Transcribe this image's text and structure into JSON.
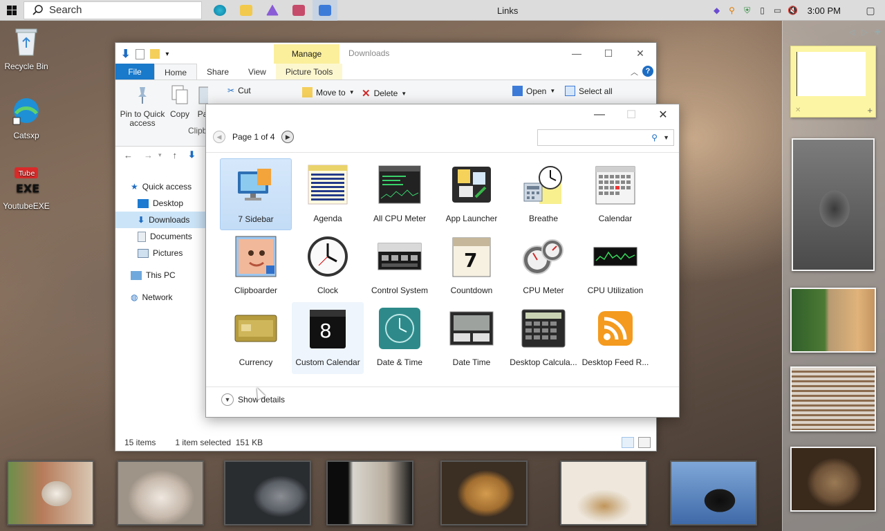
{
  "taskbar": {
    "search_placeholder": "Search",
    "window_title": "Links",
    "clock": "3:00 PM"
  },
  "desktop_icons": [
    {
      "label": "Recycle Bin"
    },
    {
      "label": "Catsxp"
    },
    {
      "label": "YoutubeEXE"
    }
  ],
  "explorer": {
    "manage_tab": "Manage",
    "title": "Downloads",
    "tabs": {
      "file": "File",
      "home": "Home",
      "share": "Share",
      "view": "View",
      "picture_tools": "Picture Tools"
    },
    "ribbon": {
      "pin": "Pin to Quick access",
      "copy": "Copy",
      "paste": "Pa",
      "cut": "Cut",
      "move_to": "Move to",
      "delete": "Delete",
      "open": "Open",
      "select_all": "Select all",
      "clipboard_group": "Clipb"
    },
    "nav": [
      {
        "label": "Quick access"
      },
      {
        "label": "Desktop"
      },
      {
        "label": "Downloads"
      },
      {
        "label": "Documents"
      },
      {
        "label": "Pictures"
      },
      {
        "label": "This PC"
      },
      {
        "label": "Network"
      }
    ],
    "status": {
      "items": "15 items",
      "selected": "1 item selected  151 KB"
    }
  },
  "gadgets": {
    "page": "Page 1 of 4",
    "search_placeholder": "",
    "items": [
      {
        "label": "7 Sidebar",
        "icon": "monitor-icon"
      },
      {
        "label": "Agenda",
        "icon": "agenda-icon"
      },
      {
        "label": "All CPU Meter",
        "icon": "cpu-meter-icon"
      },
      {
        "label": "App Launcher",
        "icon": "app-launcher-icon"
      },
      {
        "label": "Breathe",
        "icon": "breathe-icon"
      },
      {
        "label": "Calendar",
        "icon": "calendar-icon"
      },
      {
        "label": "Clipboarder",
        "icon": "clipboarder-icon"
      },
      {
        "label": "Clock",
        "icon": "clock-icon"
      },
      {
        "label": "Control System",
        "icon": "control-system-icon"
      },
      {
        "label": "Countdown",
        "icon": "countdown-icon"
      },
      {
        "label": "CPU Meter",
        "icon": "cpu-gauge-icon"
      },
      {
        "label": "CPU Utilization",
        "icon": "cpu-utilization-icon"
      },
      {
        "label": "Currency",
        "icon": "currency-icon"
      },
      {
        "label": "Custom Calendar",
        "icon": "custom-calendar-icon"
      },
      {
        "label": "Date & Time",
        "icon": "date-time-icon"
      },
      {
        "label": "Date Time",
        "icon": "date-time-digital-icon"
      },
      {
        "label": "Desktop Calcula...",
        "icon": "calculator-icon"
      },
      {
        "label": "Desktop Feed R...",
        "icon": "rss-icon"
      }
    ],
    "details": "Show details"
  }
}
